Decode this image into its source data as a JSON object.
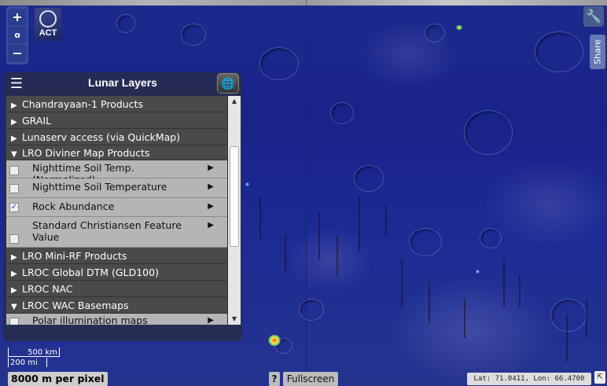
{
  "zoom": {
    "in_label": "+",
    "reset_label": "o",
    "out_label": "−"
  },
  "logo": {
    "text": "ACT"
  },
  "share": {
    "label": "Share"
  },
  "panel": {
    "title": "Lunar Layers",
    "categories_top": [
      {
        "label": "Chandrayaan-1 Products",
        "expanded": false
      },
      {
        "label": "GRAIL",
        "expanded": false
      },
      {
        "label": "Lunaserv access (via QuickMap)",
        "expanded": false
      },
      {
        "label": "LRO Diviner Map Products",
        "expanded": true
      }
    ],
    "diviner_items": [
      {
        "label": "Nighttime Soil Temp. (Normalized)",
        "checked": false
      },
      {
        "label": "Nighttime Soil Temperature",
        "checked": false
      },
      {
        "label": "Rock Abundance",
        "checked": true
      },
      {
        "label": "Standard Christiansen Feature Value",
        "checked": false
      }
    ],
    "categories_bottom": [
      {
        "label": "LRO Mini-RF Products",
        "expanded": false
      },
      {
        "label": "LROC Global DTM (GLD100)",
        "expanded": false
      },
      {
        "label": "LROC NAC",
        "expanded": false
      },
      {
        "label": "LROC WAC Basemaps",
        "expanded": true
      }
    ],
    "wac_items": [
      {
        "label": "Polar illumination maps",
        "checked": false
      }
    ]
  },
  "scale": {
    "km": "500 km",
    "mi": "200 mi"
  },
  "resolution": "8000 m per pixel",
  "help_label": "?",
  "fullscreen_label": "Fullscreen",
  "coords": "Lat:  71.0411, Lon:  66.4700",
  "icons": {
    "layers": "layers-icon",
    "globe": "globe-icon",
    "wrench": "wrench-icon",
    "expand": "expand-icon"
  }
}
